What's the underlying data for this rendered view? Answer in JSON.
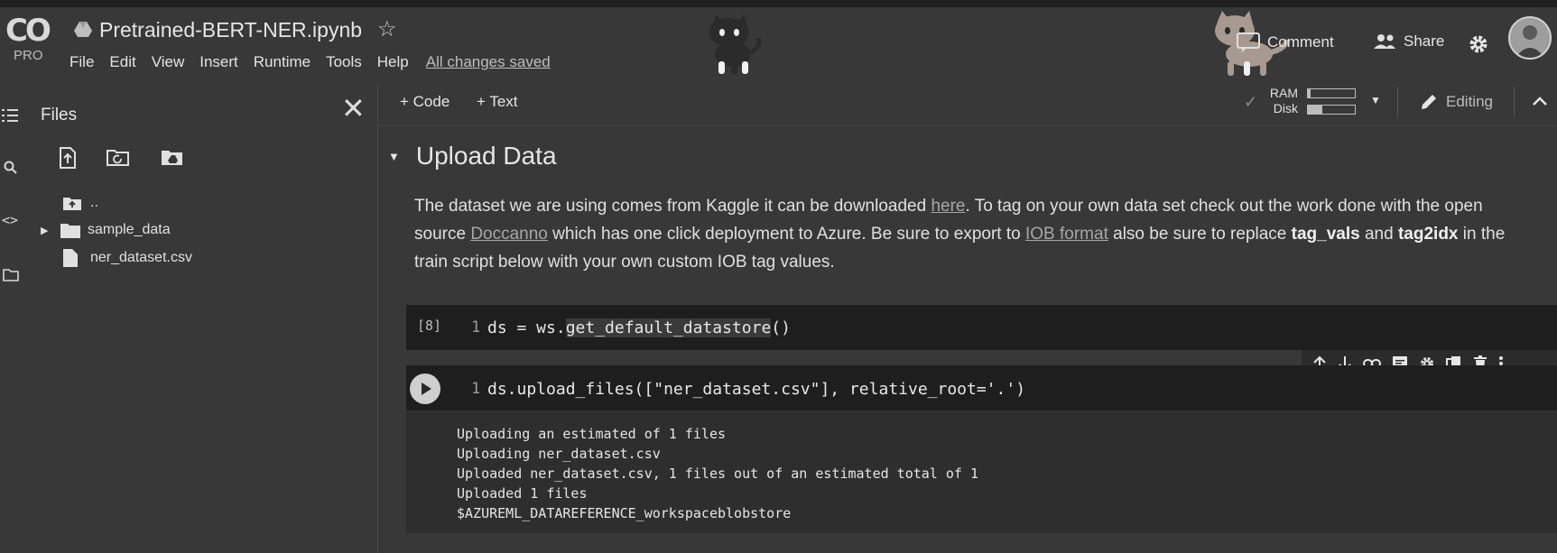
{
  "app": {
    "logo_text": "CO",
    "logo_badge": "PRO",
    "notebook_title": "Pretrained-BERT-NER.ipynb",
    "menu": [
      "File",
      "Edit",
      "View",
      "Insert",
      "Runtime",
      "Tools",
      "Help"
    ],
    "save_status": "All changes saved",
    "comment_label": "Comment",
    "share_label": "Share"
  },
  "sidebar": {
    "title": "Files",
    "tree": [
      {
        "name": "..",
        "type": "parent-folder"
      },
      {
        "name": "sample_data",
        "type": "folder"
      },
      {
        "name": "ner_dataset.csv",
        "type": "file"
      }
    ]
  },
  "toolbar": {
    "add_code": "+ Code",
    "add_text": "+ Text",
    "ram_label": "RAM",
    "disk_label": "Disk",
    "ram_usage": 0.05,
    "disk_usage": 0.3,
    "mode_label": "Editing"
  },
  "section": {
    "title": "Upload Data"
  },
  "paragraph": {
    "t1": "The dataset we are using comes from Kaggle it can be downloaded ",
    "link1": "here",
    "t2": ". To tag on your own data set check out the work done with the open source ",
    "link2": "Doccanno",
    "t3": " which has one click deployment to Azure. Be sure to export to ",
    "link3": "IOB format",
    "t4": " also be sure to replace ",
    "bold1": "tag_vals",
    "t5": " and ",
    "bold2": "tag2idx",
    "t6": " in the train script below with your own custom IOB tag values."
  },
  "cells": [
    {
      "exec_count": "[8]",
      "line_no": "1",
      "code_prefix": "ds = ws.",
      "code_highlight": "get_default_datastore",
      "code_suffix": "()"
    },
    {
      "line_no": "1",
      "code": "ds.upload_files([\"ner_dataset.csv\"], relative_root='.')",
      "output": [
        "Uploading an estimated of 1 files",
        "Uploading ner_dataset.csv",
        "Uploaded ner_dataset.csv, 1 files out of an estimated total of 1",
        "Uploaded 1 files",
        "$AZUREML_DATAREFERENCE_workspaceblobstore"
      ]
    }
  ],
  "colors": {
    "background": "#383838",
    "code_cell": "#1e1e1e",
    "output": "#2e2e2e"
  }
}
